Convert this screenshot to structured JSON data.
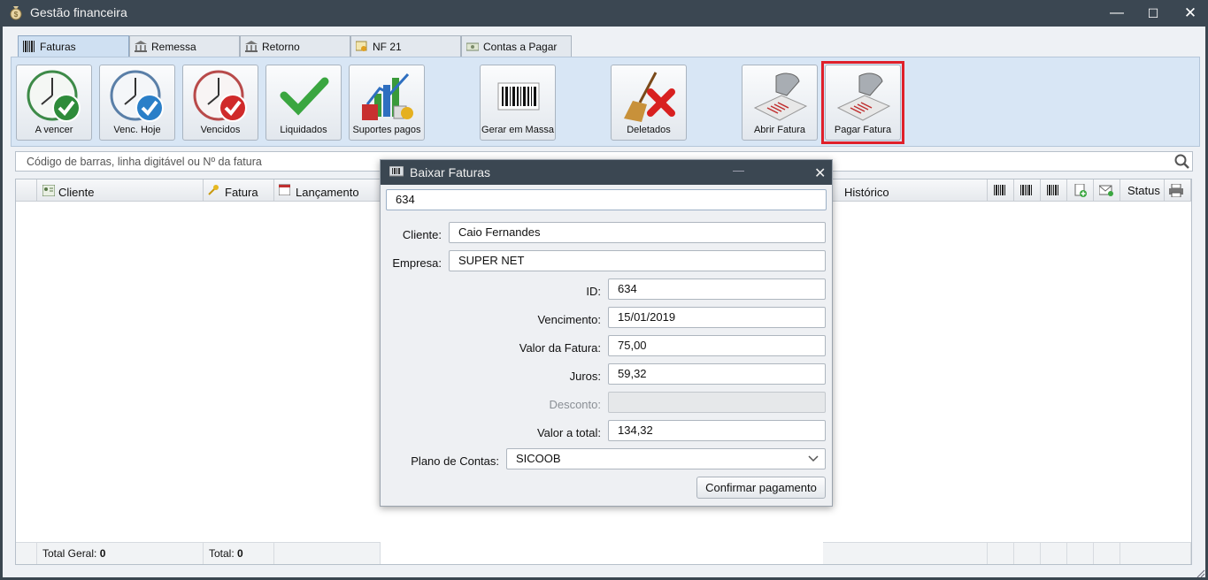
{
  "window": {
    "title": "Gestão financeira",
    "minimize": "—",
    "maximize": "☐",
    "close": "✕"
  },
  "tabs": [
    {
      "label": "Faturas",
      "icon": "barcode-icon",
      "active": true
    },
    {
      "label": "Remessa",
      "icon": "bank-icon"
    },
    {
      "label": "Retorno",
      "icon": "bank-icon"
    },
    {
      "label": "NF 21",
      "icon": "certificate-icon"
    },
    {
      "label": "Contas a Pagar",
      "icon": "money-icon"
    }
  ],
  "toolbar": {
    "buttons": [
      {
        "label": "A vencer",
        "icon": "clock-green-check-icon"
      },
      {
        "label": "Venc. Hoje",
        "icon": "clock-blue-check-icon"
      },
      {
        "label": "Vencidos",
        "icon": "clock-red-check-icon"
      },
      {
        "label": "Liquidados",
        "icon": "green-check-icon"
      },
      {
        "label": "Suportes pagos",
        "icon": "chart-docs-icon"
      },
      {
        "label": "Gerar em Massa",
        "icon": "barcode-icon"
      },
      {
        "label": "Deletados",
        "icon": "broom-delete-icon"
      },
      {
        "label": "Abrir Fatura",
        "icon": "barcode-scanner-icon"
      },
      {
        "label": "Pagar Fatura",
        "icon": "barcode-scanner-icon",
        "highlighted": true
      }
    ]
  },
  "search": {
    "placeholder": "Código de barras, linha digitável ou Nº da fatura"
  },
  "grid": {
    "columns": [
      "Cliente",
      "Fatura",
      "Lançamento",
      "Histórico",
      "Status"
    ],
    "footer": {
      "total_geral_label": "Total Geral:",
      "total_geral_value": "0",
      "total_label": "Total:",
      "total_value": "0"
    }
  },
  "dialog": {
    "title": "Baixar Faturas",
    "minimize": "—",
    "close": "✕",
    "search_value": "634",
    "fields": {
      "cliente": {
        "label": "Cliente:",
        "value": "Caio Fernandes"
      },
      "empresa": {
        "label": "Empresa:",
        "value": "SUPER NET"
      },
      "id": {
        "label": "ID:",
        "value": "634"
      },
      "vencimento": {
        "label": "Vencimento:",
        "value": "15/01/2019"
      },
      "valor_fatura": {
        "label": "Valor da Fatura:",
        "value": "75,00"
      },
      "juros": {
        "label": "Juros:",
        "value": "59,32"
      },
      "desconto": {
        "label": "Desconto:",
        "value": ""
      },
      "valor_total": {
        "label": "Valor a total:",
        "value": "134,32"
      },
      "plano_contas": {
        "label": "Plano de Contas:",
        "value": "SICOOB"
      }
    },
    "confirm_label": "Confirmar pagamento"
  },
  "colors": {
    "titlebar": "#3b4752",
    "highlight": "#e0202a",
    "toolbar_bg": "#d8e6f5"
  }
}
